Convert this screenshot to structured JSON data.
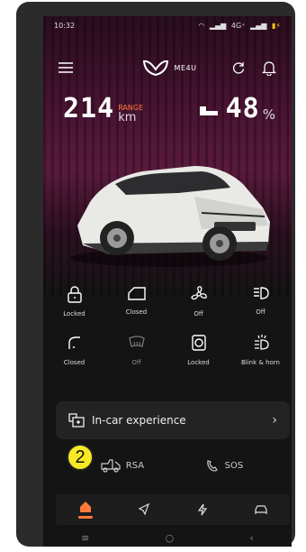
{
  "status_bar": {
    "time": "10:32",
    "network": "4G⁺"
  },
  "header": {
    "brand": "ME4U"
  },
  "stats": {
    "range_value": "214",
    "range_label": "RANGE",
    "range_unit": "km",
    "battery_value": "48",
    "battery_unit": "%"
  },
  "controls_row1": [
    {
      "icon": "lock-icon",
      "label": "Locked"
    },
    {
      "icon": "door-icon",
      "label": "Closed"
    },
    {
      "icon": "fan-icon",
      "label": "Off"
    },
    {
      "icon": "headlight-icon",
      "label": "Off"
    }
  ],
  "controls_row2": [
    {
      "icon": "window-icon",
      "label": "Closed"
    },
    {
      "icon": "defrost-icon",
      "label": "Off"
    },
    {
      "icon": "charge-port-icon",
      "label": "Locked"
    },
    {
      "icon": "blink-horn-icon",
      "label": "Blink & horn"
    }
  ],
  "experience": {
    "label": "In-car experience"
  },
  "quick_actions": {
    "rsa": "RSA",
    "sos": "SOS"
  },
  "annotation": {
    "step": "2"
  },
  "tabs": [
    {
      "icon": "home-icon",
      "active": true
    },
    {
      "icon": "navigate-icon",
      "active": false
    },
    {
      "icon": "charging-icon",
      "active": false
    },
    {
      "icon": "car-icon",
      "active": false
    }
  ],
  "colors": {
    "accent": "#ff7a3a",
    "badge": "#f7e923",
    "background": "#141414",
    "hero": "#5a1a3c"
  }
}
